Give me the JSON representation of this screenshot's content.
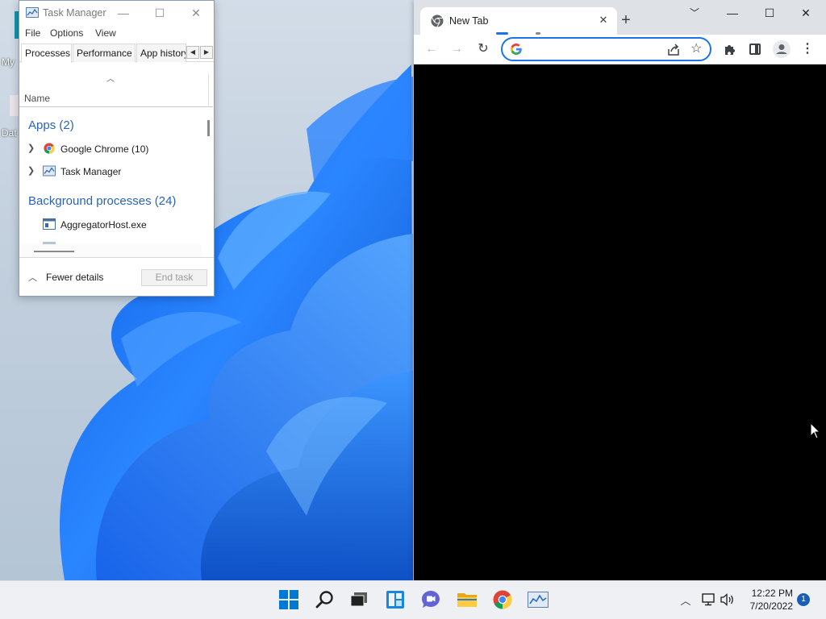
{
  "desktop": {
    "icons": [
      {
        "label": "My",
        "icon": "desktop-app-icon"
      },
      {
        "label": "Dat",
        "icon": "shortcut-icon"
      }
    ]
  },
  "task_manager": {
    "title": "Task Manager",
    "menu": [
      "File",
      "Options",
      "View"
    ],
    "tabs": [
      "Processes",
      "Performance",
      "App history"
    ],
    "active_tab": "Processes",
    "column_header": "Name",
    "groups": [
      {
        "label": "Apps (2)",
        "rows": [
          {
            "label": "Google Chrome (10)",
            "icon": "chrome-icon",
            "expandable": true
          },
          {
            "label": "Task Manager",
            "icon": "task-manager-icon",
            "expandable": true
          }
        ]
      },
      {
        "label": "Background processes (24)",
        "rows": [
          {
            "label": "AggregatorHost.exe",
            "icon": "process-icon",
            "expandable": false
          }
        ]
      }
    ],
    "fewer_details": "Fewer details",
    "end_task": "End task"
  },
  "chrome": {
    "tab_title": "New Tab",
    "omnibox": {
      "value": "",
      "placeholder": ""
    },
    "toolbar_icons": [
      "back-icon",
      "forward-icon",
      "reload-icon",
      "google-icon",
      "share-icon",
      "star-icon",
      "extensions-icon",
      "side-panel-icon",
      "profile-icon",
      "menu-icon"
    ]
  },
  "taskbar": {
    "apps": [
      "Start",
      "Search",
      "Task View",
      "Widgets",
      "Teams",
      "File Explorer",
      "Google Chrome",
      "Task Manager"
    ],
    "active_app": "Google Chrome",
    "time": "12:22 PM",
    "date": "7/20/2022",
    "notification_count": "1"
  },
  "colors": {
    "wallpaper_blue": "#1e6ff0",
    "group_header": "#2a64b3",
    "chrome_focus": "#1a73e8",
    "taskbar": "#eef0f4"
  }
}
